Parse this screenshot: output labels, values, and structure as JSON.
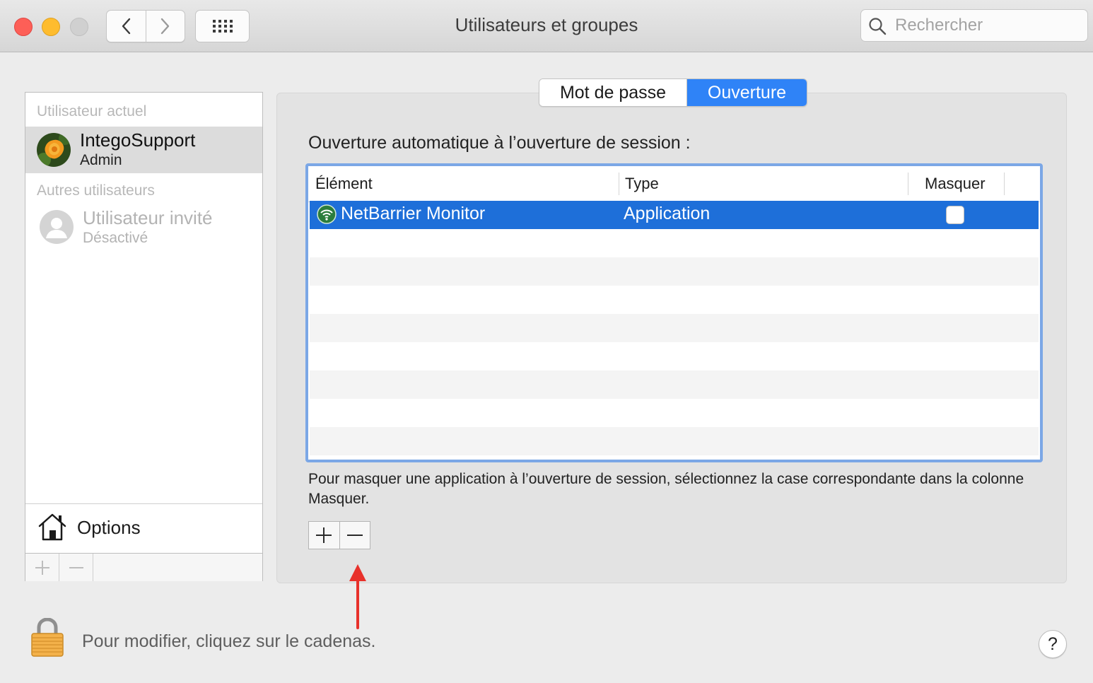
{
  "window": {
    "title": "Utilisateurs et groupes",
    "search_placeholder": "Rechercher"
  },
  "sidebar": {
    "current_user_section": "Utilisateur actuel",
    "current_user": {
      "name": "IntegoSupport",
      "role": "Admin"
    },
    "other_users_section": "Autres utilisateurs",
    "guest_user": {
      "name": "Utilisateur invité",
      "status": "Désactivé"
    },
    "options_label": "Options"
  },
  "tabs": [
    {
      "label": "Mot de passe",
      "selected": false
    },
    {
      "label": "Ouverture",
      "selected": true
    }
  ],
  "main": {
    "section_title": "Ouverture automatique à l’ouverture de session :",
    "table": {
      "columns": [
        "Élément",
        "Type",
        "Masquer"
      ],
      "rows": [
        {
          "element": "NetBarrier Monitor",
          "type": "Application",
          "hide": false,
          "selected": true
        }
      ]
    },
    "hint": "Pour masquer une application à l’ouverture de session, sélectionnez la case correspondante dans la colonne Masquer."
  },
  "footer": {
    "lock_text": "Pour modifier, cliquez sur le cadenas.",
    "help_label": "?"
  },
  "colors": {
    "accent": "#2f83f7",
    "selection": "#1e6fd9",
    "annotation_arrow": "#e8312b"
  }
}
